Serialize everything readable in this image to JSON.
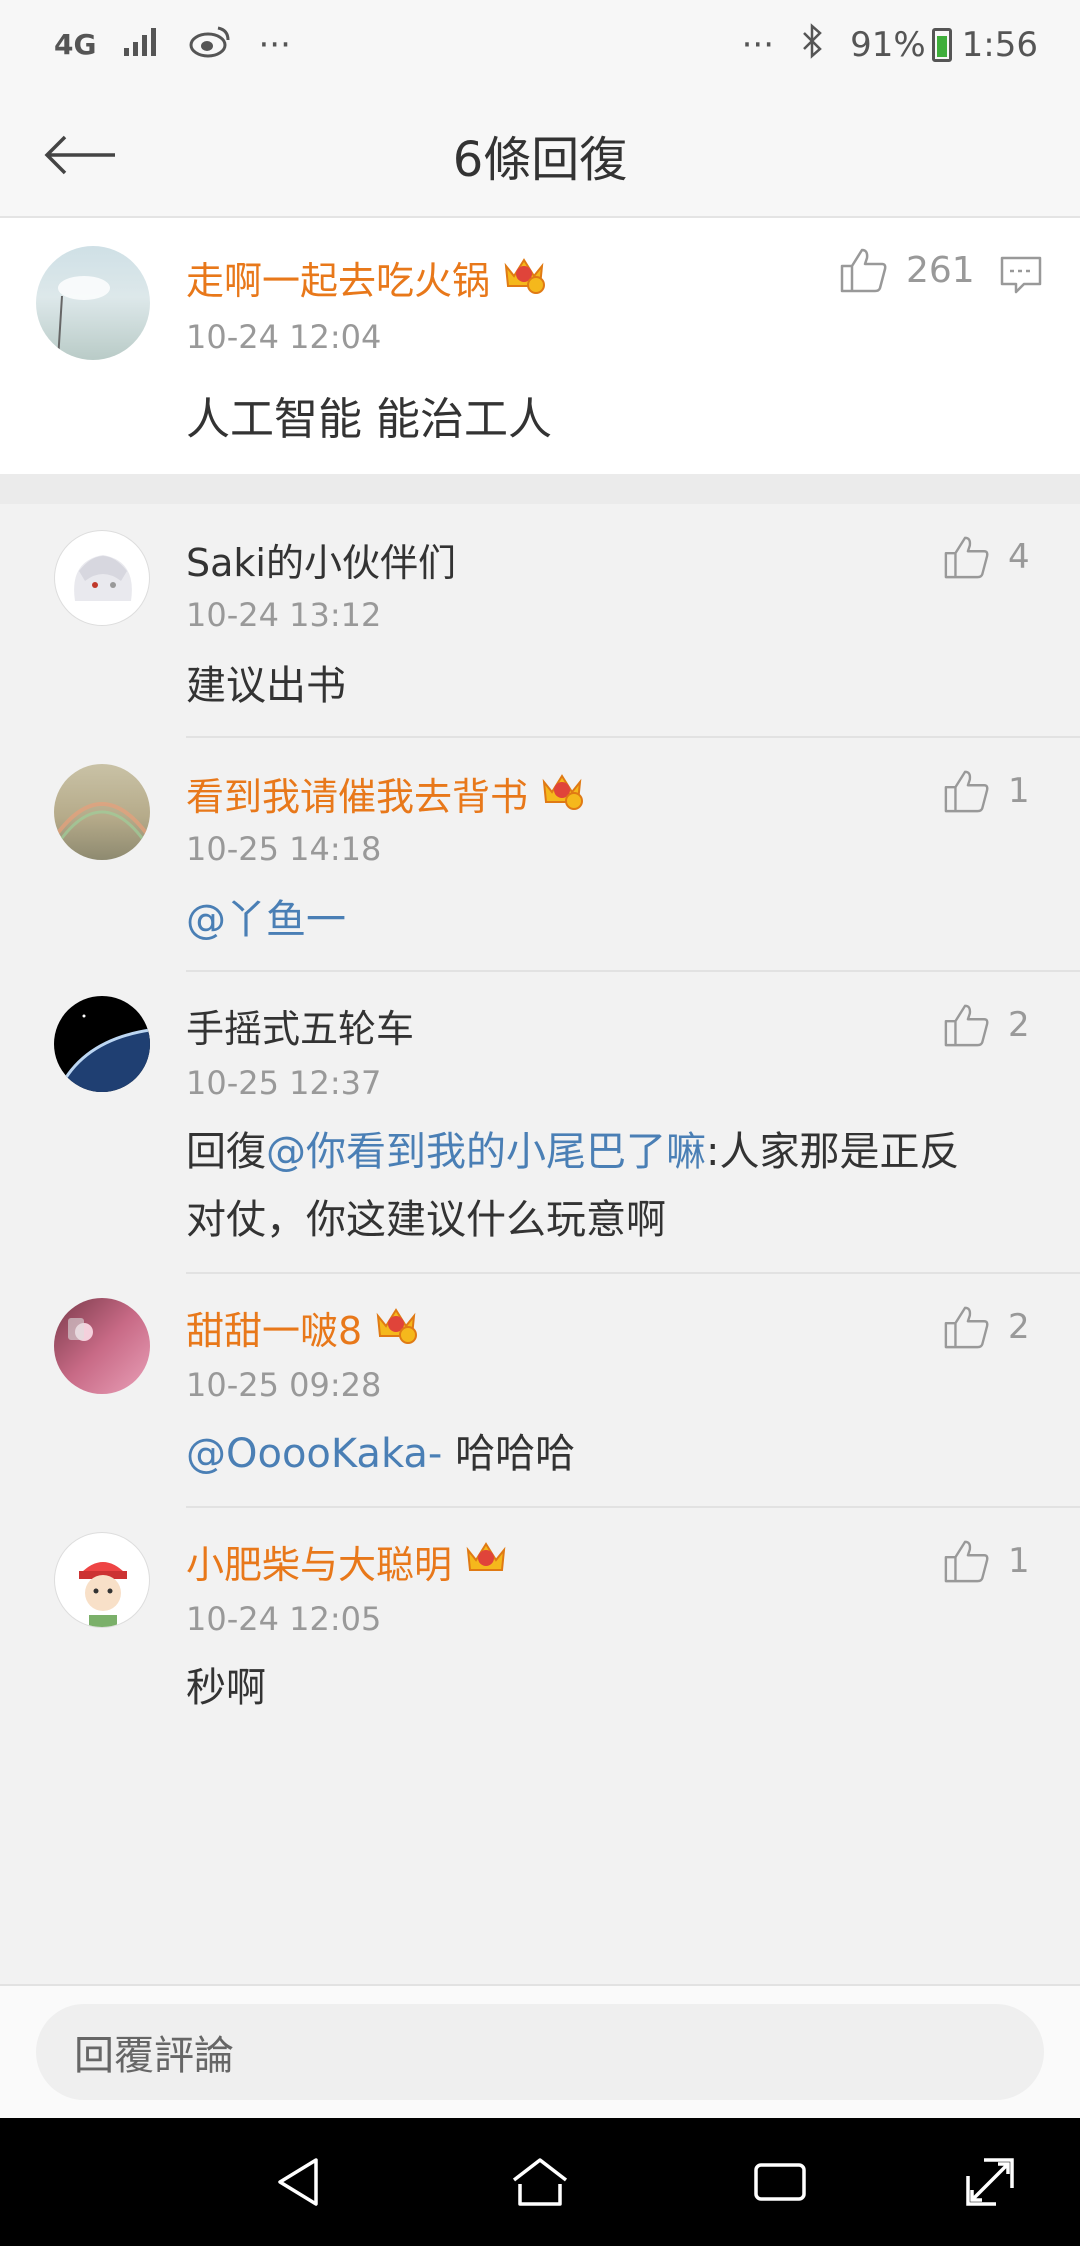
{
  "status_bar": {
    "network": "4G",
    "more": "···",
    "more_right": "···",
    "battery": "91%",
    "time": "1:56"
  },
  "header": {
    "title": "6條回復"
  },
  "main_comment": {
    "user": "走啊一起去吃火锅",
    "time": "10-24 12:04",
    "text": "人工智能 能治工人",
    "likes": "261"
  },
  "replies": [
    {
      "user": "Saki的小伙伴们",
      "vip": false,
      "time": "10-24 13:12",
      "text": "建议出书",
      "likes": "4"
    },
    {
      "user": "看到我请催我去背书",
      "vip": true,
      "time": "10-25 14:18",
      "mention": "@丫鱼一",
      "likes": "1"
    },
    {
      "user": "手摇式五轮车",
      "vip": false,
      "time": "10-25 12:37",
      "prefix": "回復",
      "mention": "@你看到我的小尾巴了嘛",
      "text_line1": ":人家那是正反",
      "text_line2": "对仗，你这建议什么玩意啊",
      "likes": "2"
    },
    {
      "user": "甜甜一啵8",
      "vip": true,
      "time": "10-25 09:28",
      "mention": "@OoooKaka-",
      "text": " 哈哈哈",
      "likes": "2"
    },
    {
      "user": "小肥柴与大聪明",
      "vip": true,
      "time": "10-24 12:05",
      "text": "秒啊",
      "likes": "1"
    }
  ],
  "input": {
    "placeholder": "回覆評論"
  },
  "colors": {
    "vip_name": "#e8781a",
    "mention": "#4a7fb5",
    "time": "#999999"
  }
}
